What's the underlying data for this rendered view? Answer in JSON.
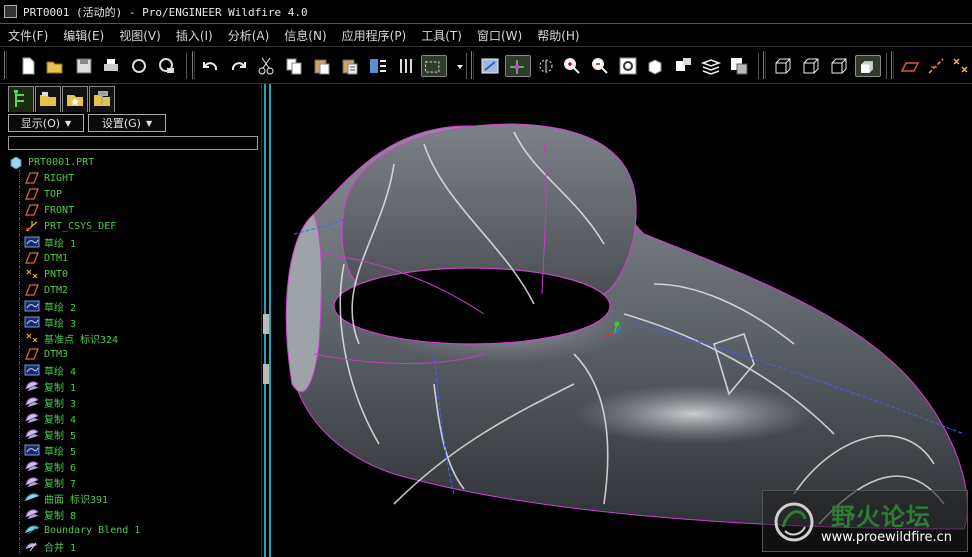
{
  "window": {
    "title": "PRT0001 (活动的) - Pro/ENGINEER Wildfire 4.0"
  },
  "menu": [
    {
      "label": "文件(F)"
    },
    {
      "label": "编辑(E)"
    },
    {
      "label": "视图(V)"
    },
    {
      "label": "插入(I)"
    },
    {
      "label": "分析(A)"
    },
    {
      "label": "信息(N)"
    },
    {
      "label": "应用程序(P)"
    },
    {
      "label": "工具(T)"
    },
    {
      "label": "窗口(W)"
    },
    {
      "label": "帮助(H)"
    }
  ],
  "toolbar_icons": [
    "new-icon",
    "open-icon",
    "save-icon",
    "print-icon",
    "send-icon",
    "send-mail-icon",
    "undo-icon",
    "redo-icon",
    "cut-icon",
    "copy-icon",
    "paste-icon",
    "paste-special-icon",
    "regenerate-icon",
    "regenerate-manager-icon",
    "select-box-icon",
    "repaint-icon",
    "spin-center-icon",
    "orient-icon",
    "zoom-in-icon",
    "zoom-out-icon",
    "refit-icon",
    "saved-view-icon",
    "reorient-icon",
    "view-manager-icon",
    "layers-icon",
    "wireframe-icon",
    "hidden-line-icon",
    "no-hidden-icon",
    "shading-icon",
    "datum-plane-display-icon",
    "datum-axis-display-icon",
    "datum-point-display-icon"
  ],
  "panel": {
    "show_label": "显示(O)",
    "settings_label": "设置(G)",
    "root_label": "PRT0001.PRT",
    "items": [
      {
        "label": "RIGHT",
        "icon": "datum-plane-icon"
      },
      {
        "label": "TOP",
        "icon": "datum-plane-icon"
      },
      {
        "label": "FRONT",
        "icon": "datum-plane-icon"
      },
      {
        "label": "PRT_CSYS_DEF",
        "icon": "csys-icon"
      },
      {
        "label": "草绘 1",
        "icon": "sketch-icon"
      },
      {
        "label": "DTM1",
        "icon": "datum-plane-icon"
      },
      {
        "label": "PNT0",
        "icon": "datum-point-icon"
      },
      {
        "label": "DTM2",
        "icon": "datum-plane-icon"
      },
      {
        "label": "草绘 2",
        "icon": "sketch-icon"
      },
      {
        "label": "草绘 3",
        "icon": "sketch-icon"
      },
      {
        "label": "基准点 标识324",
        "icon": "datum-point-icon"
      },
      {
        "label": "DTM3",
        "icon": "datum-plane-icon"
      },
      {
        "label": "草绘 4",
        "icon": "sketch-icon"
      },
      {
        "label": "复制 1",
        "icon": "copy-feature-icon"
      },
      {
        "label": "复制 3",
        "icon": "copy-feature-icon"
      },
      {
        "label": "复制 4",
        "icon": "copy-feature-icon"
      },
      {
        "label": "复制 5",
        "icon": "copy-feature-icon"
      },
      {
        "label": "草绘 5",
        "icon": "sketch-icon"
      },
      {
        "label": "复制 6",
        "icon": "copy-feature-icon"
      },
      {
        "label": "复制 7",
        "icon": "copy-feature-icon"
      },
      {
        "label": "曲面 标识391",
        "icon": "surface-icon"
      },
      {
        "label": "复制 8",
        "icon": "copy-feature-icon"
      },
      {
        "label": "Boundary Blend 1",
        "icon": "boundary-blend-icon"
      },
      {
        "label": "合并 1",
        "icon": "merge-icon"
      }
    ]
  },
  "watermark": {
    "title": "野火论坛",
    "url": "www.proewildfire.cn"
  },
  "colors": {
    "tree_text": "#4ec94e",
    "surface_edge": "#d040d0",
    "background": "#000000",
    "splitter": "#1fa7b4"
  }
}
